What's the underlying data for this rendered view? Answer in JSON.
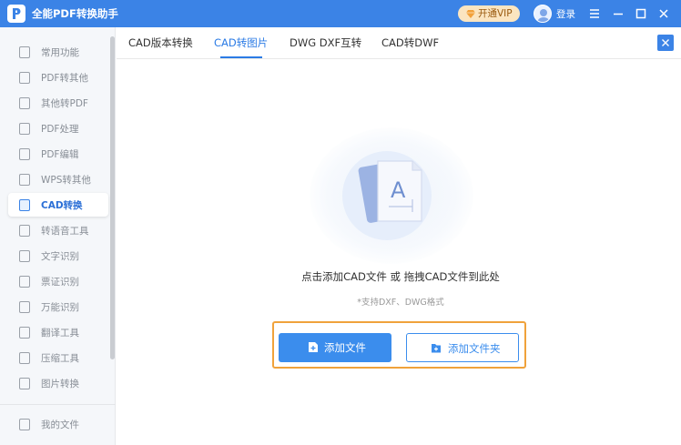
{
  "app": {
    "title": "全能PDF转换助手"
  },
  "header": {
    "vip_label": "开通VIP",
    "login_label": "登录"
  },
  "sidebar": {
    "items": [
      {
        "label": "常用功能"
      },
      {
        "label": "PDF转其他"
      },
      {
        "label": "其他转PDF"
      },
      {
        "label": "PDF处理"
      },
      {
        "label": "PDF编辑"
      },
      {
        "label": "WPS转其他"
      },
      {
        "label": "CAD转换",
        "active": true
      },
      {
        "label": "转语音工具"
      },
      {
        "label": "文字识别"
      },
      {
        "label": "票证识别"
      },
      {
        "label": "万能识别"
      },
      {
        "label": "翻译工具"
      },
      {
        "label": "压缩工具"
      },
      {
        "label": "图片转换"
      }
    ],
    "bottom": {
      "label": "我的文件"
    }
  },
  "tabs": [
    {
      "label": "CAD版本转换"
    },
    {
      "label": "CAD转图片",
      "active": true
    },
    {
      "label": "DWG DXF互转"
    },
    {
      "label": "CAD转DWF"
    }
  ],
  "main": {
    "drop_hint": "点击添加CAD文件 或 拖拽CAD文件到此处",
    "formats_hint": "*支持DXF、DWG格式",
    "add_file_label": "添加文件",
    "add_folder_label": "添加文件夹"
  },
  "colors": {
    "accent": "#3b83e6",
    "highlight": "#f0a23b",
    "vip_bg": "#fbe5c0"
  }
}
